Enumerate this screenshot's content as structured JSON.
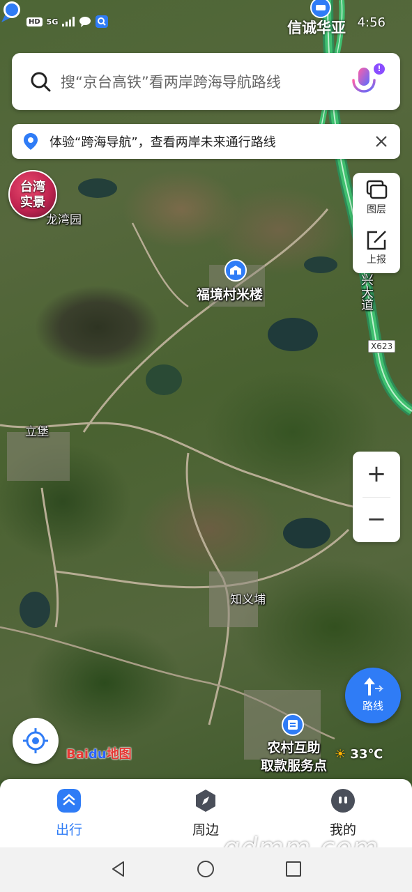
{
  "status_bar": {
    "left_chips": [
      "HD",
      "5G"
    ],
    "carrier_text": "信诚华亚",
    "time": "4:56"
  },
  "search": {
    "placeholder": "搜“京台高铁”看两岸跨海导航路线"
  },
  "notice": {
    "text": "体验“跨海导航”，查看两岸未来通行路线"
  },
  "badge": {
    "line1": "台湾",
    "line2": "实景"
  },
  "tools": {
    "layers_label": "图层",
    "report_label": "上报"
  },
  "zoom": {
    "in_label": "+",
    "out_label": "−"
  },
  "route": {
    "label": "路线"
  },
  "map_labels": {
    "longwan": "龙湾园",
    "fujing": "福境村米楼",
    "libao": "立堡",
    "zhiyi": "知义埔",
    "road_badge": "X623",
    "road_name": "兴大道",
    "poi_line1": "农村互助",
    "poi_line2": "取款服务点"
  },
  "baidu_logo": {
    "bai": "Bai",
    "du": "du",
    "map": "地图"
  },
  "weather": {
    "temp": "33℃"
  },
  "bottom_nav": {
    "items": [
      {
        "label": "出行",
        "active": true
      },
      {
        "label": "周边",
        "active": false
      },
      {
        "label": "我的",
        "active": false
      }
    ]
  },
  "watermark": "gdmm.com",
  "colors": {
    "accent_blue": "#2f7cf6",
    "highway_green": "#3fbf6f",
    "mic_purple": "#8a4dff"
  }
}
